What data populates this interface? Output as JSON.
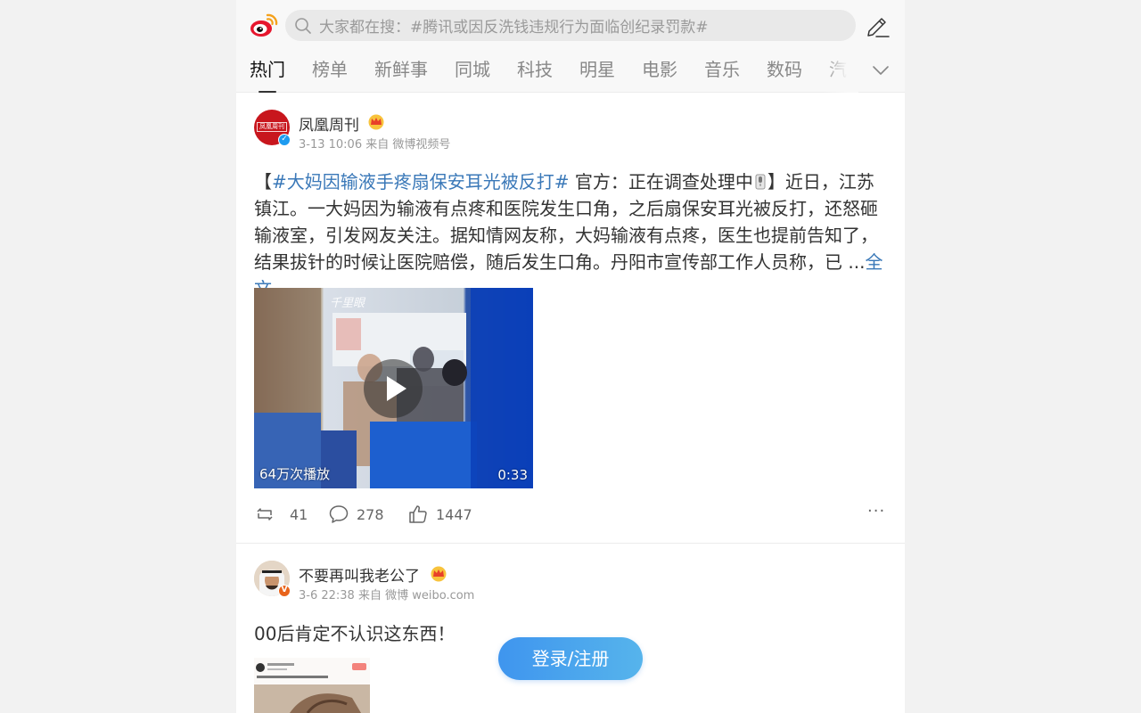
{
  "header": {
    "search_placeholder": "大家都在搜：#腾讯或因反洗钱违规行为面临创纪录罚款#",
    "logo_icon": "weibo-logo-icon",
    "search_icon": "search-icon",
    "compose_icon": "edit-icon"
  },
  "tabs": {
    "items": [
      "热门",
      "榜单",
      "新鲜事",
      "同城",
      "科技",
      "明星",
      "电影",
      "音乐",
      "数码",
      "汽车"
    ],
    "active_index": 0,
    "more_icon": "chevron-down-icon"
  },
  "posts": [
    {
      "author": "凤凰周刊",
      "time_source": "3-13 10:06 来自 微博视频号",
      "avatar_text": "凤凰周刊",
      "text_link": "#大妈因输液手疼扇保安耳光被反打#",
      "text_open": "【",
      "text_after_link": " 官方：正在调查处理中",
      "text_body": "】近日，江苏镇江。一大妈因为输液有点疼和医院发生口角，之后扇保安耳光被反打，还怒砸输液室，引发网友关注。据知情网友称，大妈输液有点疼，医生也提前告知了，结果拔针的时候让医院赔偿，随后发生口角。丹阳市宣传部工作人员称，已 ...",
      "full_text_link": "全文",
      "video": {
        "watermark": "千里眼",
        "play_count": "64万次播放",
        "duration": "0:33"
      },
      "reposts": "41",
      "comments": "278",
      "likes": "1447",
      "more": "···"
    },
    {
      "author": "不要再叫我老公了",
      "time_source": "3-6 22:38 来自 微博 weibo.com",
      "text": "00后肯定不认识这东西！"
    }
  ],
  "login_button": "登录/注册",
  "colors": {
    "link": "#3a78b8",
    "verify_blue": "#1d9bf0",
    "verify_orange": "#e8641b",
    "login_gradient": [
      "#3f95ee",
      "#56b4ec"
    ]
  }
}
